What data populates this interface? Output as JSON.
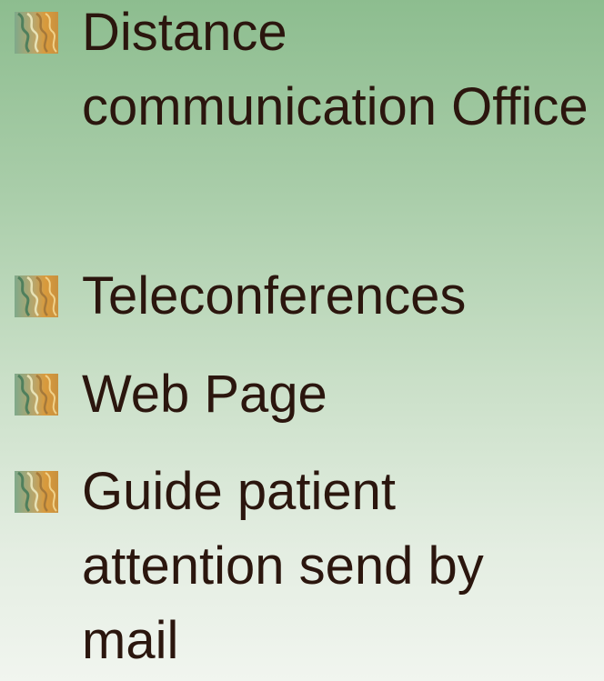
{
  "slide": {
    "bullets": [
      {
        "text": "Distance communication Office",
        "icon": "patterned-square-bullet-icon"
      },
      {
        "text": "Teleconferences",
        "icon": "patterned-square-bullet-icon"
      },
      {
        "text": "Web Page",
        "icon": "patterned-square-bullet-icon"
      },
      {
        "text": "Guide patient attention send by mail",
        "icon": "patterned-square-bullet-icon"
      }
    ]
  },
  "colors": {
    "background_top": "#8dbd8f",
    "background_bottom": "#f1f5ef",
    "text": "#2b160e",
    "bullet_orange": "#d99a3c",
    "bullet_green": "#6f9f72"
  }
}
